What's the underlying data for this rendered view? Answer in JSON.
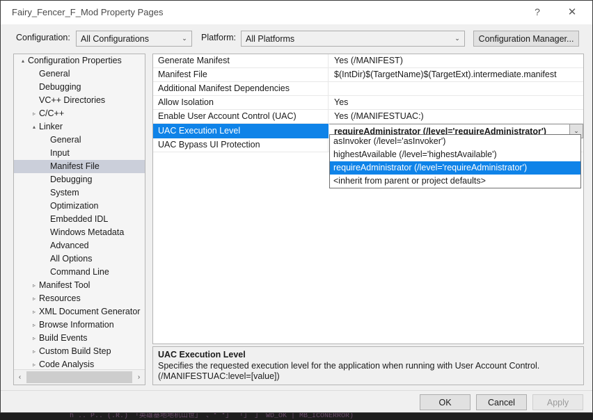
{
  "window": {
    "title": "Fairy_Fencer_F_Mod Property Pages",
    "help_label": "?",
    "close_label": "✕"
  },
  "configbar": {
    "configuration_label": "Configuration:",
    "configuration_value": "All Configurations",
    "platform_label": "Platform:",
    "platform_value": "All Platforms",
    "manager_button": "Configuration Manager...",
    "arrow_glyph": "⌄"
  },
  "tree": {
    "expanded_glyph": "▴",
    "collapsed_glyph": "▹",
    "scroll_left_glyph": "‹",
    "scroll_right_glyph": "›",
    "items": [
      {
        "label": "Configuration Properties",
        "indent": 0,
        "arrow": "expanded",
        "selected": false
      },
      {
        "label": "General",
        "indent": 1,
        "arrow": "none",
        "selected": false
      },
      {
        "label": "Debugging",
        "indent": 1,
        "arrow": "none",
        "selected": false
      },
      {
        "label": "VC++ Directories",
        "indent": 1,
        "arrow": "none",
        "selected": false
      },
      {
        "label": "C/C++",
        "indent": 1,
        "arrow": "collapsed",
        "selected": false
      },
      {
        "label": "Linker",
        "indent": 1,
        "arrow": "expanded",
        "selected": false
      },
      {
        "label": "General",
        "indent": 2,
        "arrow": "none",
        "selected": false
      },
      {
        "label": "Input",
        "indent": 2,
        "arrow": "none",
        "selected": false
      },
      {
        "label": "Manifest File",
        "indent": 2,
        "arrow": "none",
        "selected": true
      },
      {
        "label": "Debugging",
        "indent": 2,
        "arrow": "none",
        "selected": false
      },
      {
        "label": "System",
        "indent": 2,
        "arrow": "none",
        "selected": false
      },
      {
        "label": "Optimization",
        "indent": 2,
        "arrow": "none",
        "selected": false
      },
      {
        "label": "Embedded IDL",
        "indent": 2,
        "arrow": "none",
        "selected": false
      },
      {
        "label": "Windows Metadata",
        "indent": 2,
        "arrow": "none",
        "selected": false
      },
      {
        "label": "Advanced",
        "indent": 2,
        "arrow": "none",
        "selected": false
      },
      {
        "label": "All Options",
        "indent": 2,
        "arrow": "none",
        "selected": false
      },
      {
        "label": "Command Line",
        "indent": 2,
        "arrow": "none",
        "selected": false
      },
      {
        "label": "Manifest Tool",
        "indent": 1,
        "arrow": "collapsed",
        "selected": false
      },
      {
        "label": "Resources",
        "indent": 1,
        "arrow": "collapsed",
        "selected": false
      },
      {
        "label": "XML Document Generator",
        "indent": 1,
        "arrow": "collapsed",
        "selected": false
      },
      {
        "label": "Browse Information",
        "indent": 1,
        "arrow": "collapsed",
        "selected": false
      },
      {
        "label": "Build Events",
        "indent": 1,
        "arrow": "collapsed",
        "selected": false
      },
      {
        "label": "Custom Build Step",
        "indent": 1,
        "arrow": "collapsed",
        "selected": false
      },
      {
        "label": "Code Analysis",
        "indent": 1,
        "arrow": "collapsed",
        "selected": false
      }
    ]
  },
  "grid": {
    "value_arrow_glyph": "⌄",
    "rows": [
      {
        "name": "Generate Manifest",
        "value": "Yes (/MANIFEST)",
        "selected": false
      },
      {
        "name": "Manifest File",
        "value": "$(IntDir)$(TargetName)$(TargetExt).intermediate.manifest",
        "selected": false
      },
      {
        "name": "Additional Manifest Dependencies",
        "value": "",
        "selected": false
      },
      {
        "name": "Allow Isolation",
        "value": "Yes",
        "selected": false
      },
      {
        "name": "Enable User Account Control (UAC)",
        "value": "Yes (/MANIFESTUAC:)",
        "selected": false
      },
      {
        "name": "UAC Execution Level",
        "value": "requireAdministrator (/level='requireAdministrator')",
        "selected": true
      },
      {
        "name": "UAC Bypass UI Protection",
        "value": "",
        "selected": false
      }
    ]
  },
  "dropdown": {
    "options": [
      {
        "label": "asInvoker (/level='asInvoker')",
        "selected": false
      },
      {
        "label": "highestAvailable (/level='highestAvailable')",
        "selected": false
      },
      {
        "label": "requireAdministrator (/level='requireAdministrator')",
        "selected": true
      },
      {
        "label": "<inherit from parent or project defaults>",
        "selected": false
      }
    ]
  },
  "description": {
    "title": "UAC Execution Level",
    "body": "Specifies the requested execution level for the application when running with User Account Control. (/MANIFESTUAC:level=[value])"
  },
  "footer": {
    "ok_label": "OK",
    "cancel_label": "Cancel",
    "apply_label": "Apply"
  },
  "background": {
    "code_sliver": "h    ..  P.. (.R.)  「英雄基地地机山世」    、*  *」   「」      」    WD_OK | MB_ICONERROR)"
  },
  "colors": {
    "accent_selected": "#0f83e8",
    "tree_selected": "#cbcfda",
    "dialog_bg": "#f0f0f0"
  }
}
